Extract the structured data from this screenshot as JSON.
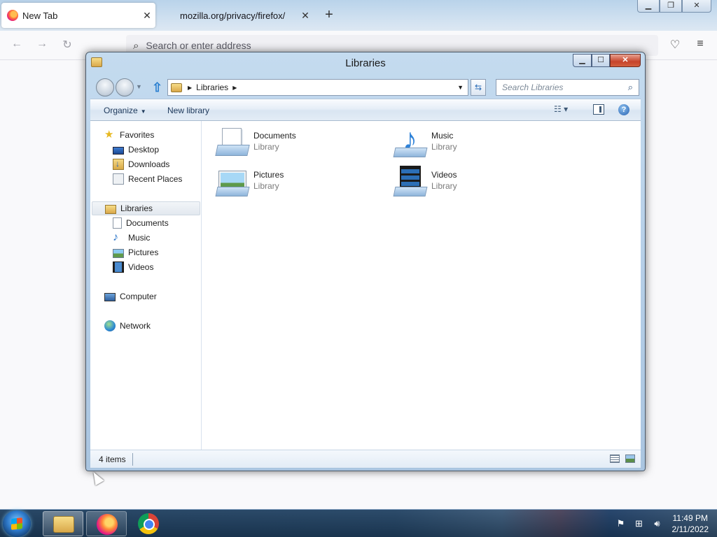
{
  "firefox": {
    "tabs": [
      {
        "title": "New Tab",
        "active": true
      },
      {
        "title": "mozilla.org/privacy/firefox/",
        "active": false
      }
    ],
    "new_tab_symbol": "+",
    "tab_close_symbol": "✕",
    "url_placeholder": "Search or enter address",
    "window_controls": {
      "minimize": "▁",
      "restore": "❐",
      "close": "✕"
    }
  },
  "explorer": {
    "title": "Libraries",
    "breadcrumb": "Libraries",
    "search_placeholder": "Search Libraries",
    "toolbar": {
      "organize": "Organize",
      "new_library": "New library"
    },
    "nav_pane": {
      "favorites": {
        "label": "Favorites",
        "items": [
          "Desktop",
          "Downloads",
          "Recent Places"
        ]
      },
      "libraries": {
        "label": "Libraries",
        "items": [
          "Documents",
          "Music",
          "Pictures",
          "Videos"
        ]
      },
      "computer": "Computer",
      "network": "Network"
    },
    "libraries": [
      {
        "name": "Documents",
        "type": "Library",
        "icon": "documents-library-icon"
      },
      {
        "name": "Music",
        "type": "Library",
        "icon": "music-library-icon"
      },
      {
        "name": "Pictures",
        "type": "Library",
        "icon": "pictures-library-icon"
      },
      {
        "name": "Videos",
        "type": "Library",
        "icon": "videos-library-icon"
      }
    ],
    "status": {
      "item_count": "4 items"
    }
  },
  "taskbar": {
    "pinned_apps": [
      "Windows Explorer",
      "Firefox",
      "Google Chrome"
    ],
    "clock": {
      "time": "11:49 PM",
      "date": "2/11/2022"
    }
  }
}
